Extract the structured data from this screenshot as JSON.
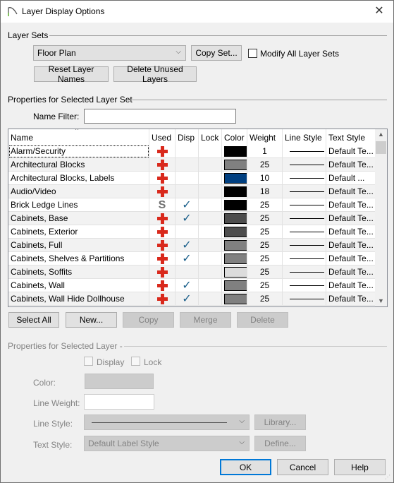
{
  "window": {
    "title": "Layer Display Options",
    "close_icon": "close-icon"
  },
  "layer_sets": {
    "group_label": "Layer Sets",
    "selected_set": "Floor Plan",
    "copy_set_label": "Copy Set...",
    "modify_all_label": "Modify All Layer Sets",
    "modify_all_checked": false,
    "reset_names_label": "Reset Layer Names",
    "delete_unused_label": "Delete Unused Layers"
  },
  "layer_set_props": {
    "group_label": "Properties for Selected Layer Set",
    "name_filter_label": "Name Filter:",
    "name_filter_value": ""
  },
  "table": {
    "columns": [
      "Name",
      "Used",
      "Disp",
      "Lock",
      "Color",
      "Weight",
      "Line Style",
      "Text Style"
    ],
    "rows": [
      {
        "name": "Alarm/Security",
        "used": "plus",
        "disp": false,
        "lock": false,
        "color": "#000000",
        "weight": "1",
        "text_style": "Default Te..."
      },
      {
        "name": "Architectural Blocks",
        "used": "plus",
        "disp": false,
        "lock": false,
        "color": "#808080",
        "weight": "25",
        "text_style": "Default Te..."
      },
      {
        "name": "Architectural Blocks, Labels",
        "used": "plus",
        "disp": false,
        "lock": false,
        "color": "#003f80",
        "weight": "10",
        "text_style": "Default ..."
      },
      {
        "name": "Audio/Video",
        "used": "plus",
        "disp": false,
        "lock": false,
        "color": "#000000",
        "weight": "18",
        "text_style": "Default Te..."
      },
      {
        "name": "Brick Ledge Lines",
        "used": "S",
        "disp": true,
        "lock": false,
        "color": "#000000",
        "weight": "25",
        "text_style": "Default Te..."
      },
      {
        "name": "Cabinets,  Base",
        "used": "plus",
        "disp": true,
        "lock": false,
        "color": "#4d4d4d",
        "weight": "25",
        "text_style": "Default Te..."
      },
      {
        "name": "Cabinets,  Exterior",
        "used": "plus",
        "disp": false,
        "lock": false,
        "color": "#4d4d4d",
        "weight": "25",
        "text_style": "Default Te..."
      },
      {
        "name": "Cabinets,  Full",
        "used": "plus",
        "disp": true,
        "lock": false,
        "color": "#808080",
        "weight": "25",
        "text_style": "Default Te..."
      },
      {
        "name": "Cabinets,  Shelves & Partitions",
        "used": "plus",
        "disp": true,
        "lock": false,
        "color": "#808080",
        "weight": "25",
        "text_style": "Default Te..."
      },
      {
        "name": "Cabinets,  Soffits",
        "used": "plus",
        "disp": false,
        "lock": false,
        "color": "#dcdcdc",
        "weight": "25",
        "text_style": "Default Te..."
      },
      {
        "name": "Cabinets,  Wall",
        "used": "plus",
        "disp": true,
        "lock": false,
        "color": "#808080",
        "weight": "25",
        "text_style": "Default Te..."
      },
      {
        "name": "Cabinets,  Wall Hide Dollhouse",
        "used": "plus",
        "disp": true,
        "lock": false,
        "color": "#808080",
        "weight": "25",
        "text_style": "Default Te..."
      }
    ]
  },
  "list_buttons": {
    "select_all": "Select All",
    "new": "New...",
    "copy": "Copy",
    "merge": "Merge",
    "delete": "Delete"
  },
  "layer_props": {
    "group_label": "Properties for Selected Layer -",
    "display_label": "Display",
    "lock_label": "Lock",
    "color_label": "Color:",
    "line_weight_label": "Line Weight:",
    "line_weight_value": "",
    "line_style_label": "Line Style:",
    "library_label": "Library...",
    "text_style_label": "Text Style:",
    "text_style_value": "Default Label Style",
    "define_label": "Define..."
  },
  "footer": {
    "ok": "OK",
    "cancel": "Cancel",
    "help": "Help"
  }
}
